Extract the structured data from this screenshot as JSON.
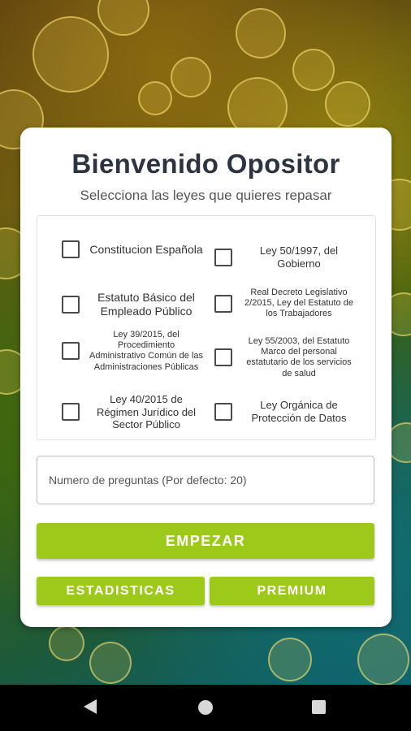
{
  "header": {
    "title": "Bienvenido Opositor",
    "subtitle": "Selecciona las leyes que quieres repasar"
  },
  "laws": [
    {
      "label": "Constitucion Española",
      "checked": false
    },
    {
      "label": "Ley 50/1997, del Gobierno",
      "checked": false
    },
    {
      "label": "Estatuto Básico del Empleado Público",
      "checked": false
    },
    {
      "label": "Real Decreto Legislativo 2/2015, Ley del Estatuto de los Trabajadores",
      "checked": false
    },
    {
      "label": "Ley 39/2015, del Procedimiento Administrativo Común de las Administraciones Públicas",
      "checked": false
    },
    {
      "label": "Ley 55/2003, del Estatuto Marco del personal estatutario de los servicios de salud",
      "checked": false
    },
    {
      "label": "Ley 40/2015 de Régimen Jurídico del Sector Público",
      "checked": false
    },
    {
      "label": "Ley Orgánica de Protección de Datos",
      "checked": false
    }
  ],
  "questions": {
    "placeholder": "Numero de preguntas (Por defecto: 20)",
    "value": ""
  },
  "buttons": {
    "start": "EMPEZAR",
    "stats": "ESTADISTICAS",
    "premium": "PREMIUM"
  },
  "colors": {
    "accent": "#9cc91a",
    "title": "#2b3440"
  },
  "navbar": {
    "back_icon": "back-triangle-icon",
    "home_icon": "home-circle-icon",
    "recents_icon": "recents-square-icon"
  }
}
